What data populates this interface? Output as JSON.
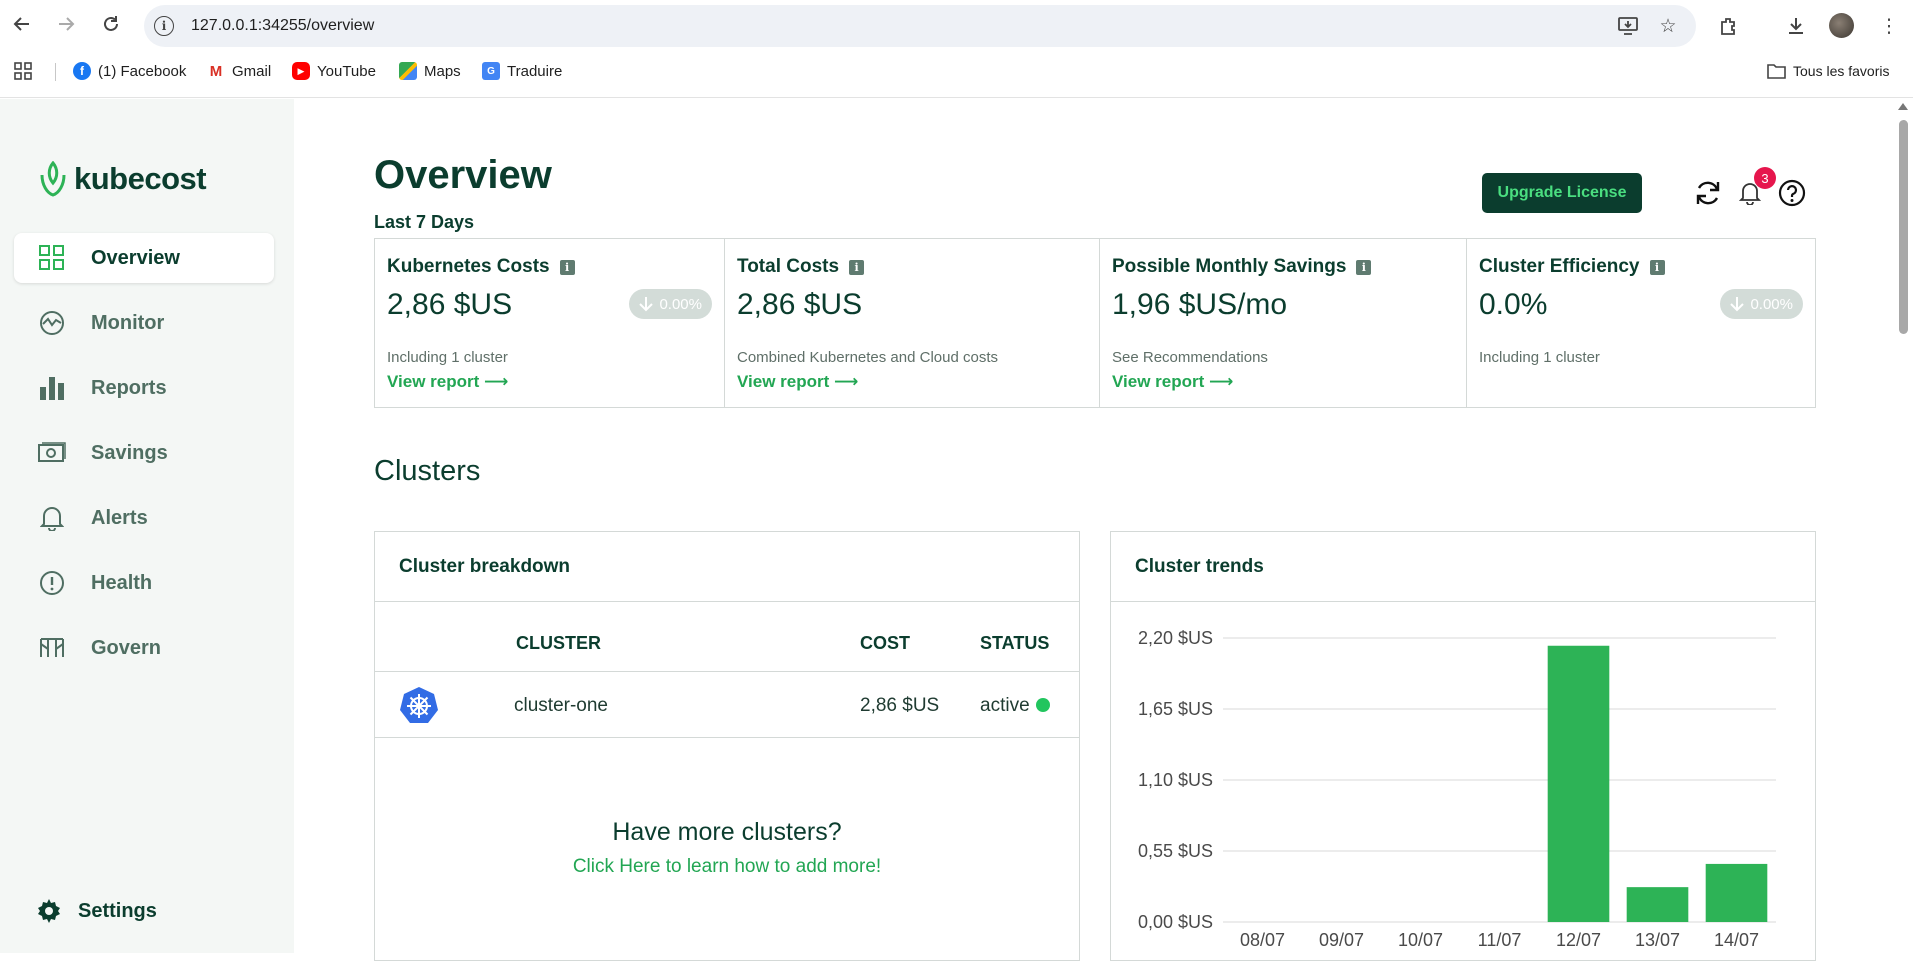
{
  "browser": {
    "url": "127.0.0.1:34255/overview",
    "bookmarks": [
      {
        "label": "(1) Facebook",
        "icon": "facebook-icon"
      },
      {
        "label": "Gmail",
        "icon": "gmail-icon"
      },
      {
        "label": "YouTube",
        "icon": "youtube-icon"
      },
      {
        "label": "Maps",
        "icon": "maps-icon"
      },
      {
        "label": "Traduire",
        "icon": "translate-icon"
      }
    ],
    "all_bookmarks": "Tous les favoris"
  },
  "sidebar": {
    "logo": "kubecost",
    "items": [
      {
        "label": "Overview",
        "icon": "grid-icon",
        "active": true
      },
      {
        "label": "Monitor",
        "icon": "monitor-icon"
      },
      {
        "label": "Reports",
        "icon": "bar-chart-icon"
      },
      {
        "label": "Savings",
        "icon": "money-icon"
      },
      {
        "label": "Alerts",
        "icon": "bell-icon"
      },
      {
        "label": "Health",
        "icon": "alert-circle-icon"
      },
      {
        "label": "Govern",
        "icon": "govern-icon"
      }
    ],
    "settings": "Settings"
  },
  "header": {
    "title": "Overview",
    "period": "Last 7 Days",
    "upgrade": "Upgrade License",
    "notifications": "3"
  },
  "kpis": [
    {
      "title": "Kubernetes Costs",
      "value": "2,86 $US",
      "delta": "0.00%",
      "desc": "Including 1 cluster",
      "link": "View report"
    },
    {
      "title": "Total Costs",
      "value": "2,86 $US",
      "delta": "",
      "desc": "Combined Kubernetes and Cloud costs",
      "link": "View report"
    },
    {
      "title": "Possible Monthly Savings",
      "value": "1,96 $US/mo",
      "delta": "",
      "desc": "See Recommendations",
      "link": "View report"
    },
    {
      "title": "Cluster Efficiency",
      "value": "0.0%",
      "delta": "0.00%",
      "desc": "Including 1 cluster",
      "link": ""
    }
  ],
  "clusters": {
    "section_title": "Clusters",
    "breakdown": {
      "title": "Cluster breakdown",
      "headers": {
        "cluster": "CLUSTER",
        "cost": "COST",
        "status": "STATUS"
      },
      "rows": [
        {
          "cluster": "cluster-one",
          "cost": "2,86 $US",
          "status": "active"
        }
      ],
      "more_title": "Have more clusters?",
      "more_link": "Click Here to learn how to add more!"
    },
    "trends_title": "Cluster trends"
  },
  "chart_data": {
    "type": "bar",
    "categories": [
      "08/07",
      "09/07",
      "10/07",
      "11/07",
      "12/07",
      "13/07",
      "14/07"
    ],
    "values": [
      0,
      0,
      0,
      0,
      2.14,
      0.27,
      0.45
    ],
    "ylim": [
      0,
      2.2
    ],
    "yticks": [
      0,
      0.55,
      1.1,
      1.65,
      2.2
    ],
    "ytick_labels": [
      "0,00 $US",
      "0,55 $US",
      "1,10 $US",
      "1,65 $US",
      "2,20 $US"
    ],
    "bar_color": "#2db356",
    "grid": true
  },
  "colors": {
    "brand_dark": "#0b3d2e",
    "accent_green": "#22a653",
    "badge_red": "#e6164d"
  }
}
